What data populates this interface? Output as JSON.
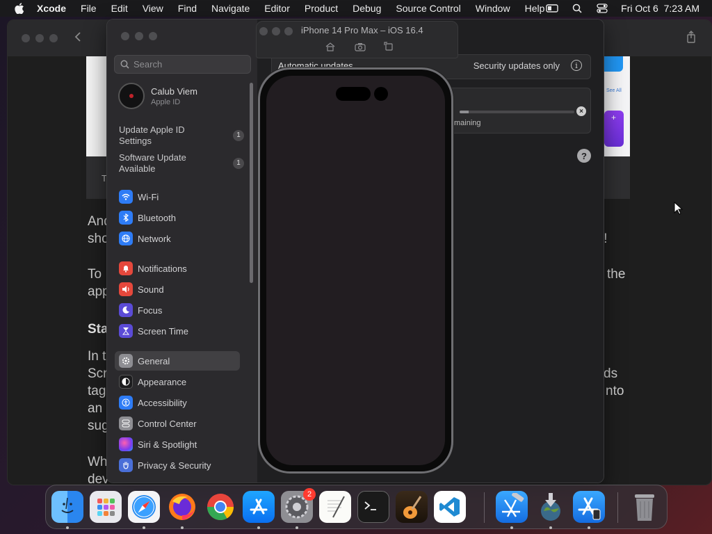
{
  "menubar": {
    "app": "Xcode",
    "items": [
      "File",
      "Edit",
      "View",
      "Find",
      "Navigate",
      "Editor",
      "Product",
      "Debug",
      "Source Control",
      "Window",
      "Help"
    ],
    "datetime": "Fri Oct 6  7:23 AM"
  },
  "browser": {
    "caption_left": "T",
    "fragments": {
      "and": "And",
      "sho": "sho",
      "t_excl": "t!",
      "to": "To",
      "the": "the",
      "app": "app",
      "sta": "Sta",
      "in_t": "In t",
      "scr": "Scr",
      "ds": "ds",
      "tag": "tag",
      "nto": "nto",
      "an_a": "an a",
      "sug": "sug",
      "wh": "Wh",
      "dev": "dev"
    },
    "see_all": "See All"
  },
  "settings": {
    "search_placeholder": "Search",
    "account": {
      "name": "Calub Viem",
      "subtitle": "Apple ID"
    },
    "notices": [
      {
        "label": "Update Apple ID Settings",
        "count": "1"
      },
      {
        "label": "Software Update Available",
        "count": "1"
      }
    ],
    "nav_items": [
      {
        "label": "Wi-Fi",
        "icon": "wifi-icon",
        "color": "#2e7cf6"
      },
      {
        "label": "Bluetooth",
        "icon": "bluetooth-icon",
        "color": "#2e7cf6"
      },
      {
        "label": "Network",
        "icon": "globe-icon",
        "color": "#2e7cf6"
      },
      {
        "label": "Notifications",
        "icon": "bell-icon",
        "color": "#e5483c"
      },
      {
        "label": "Sound",
        "icon": "speaker-icon",
        "color": "#e5483c"
      },
      {
        "label": "Focus",
        "icon": "moon-icon",
        "color": "#5b4bd6"
      },
      {
        "label": "Screen Time",
        "icon": "hourglass-icon",
        "color": "#5b4bd6"
      },
      {
        "label": "General",
        "icon": "gear-icon",
        "color": "#8e8e93"
      },
      {
        "label": "Appearance",
        "icon": "appearance-icon",
        "color": "#1c1c1e"
      },
      {
        "label": "Accessibility",
        "icon": "accessibility-icon",
        "color": "#2e7cf6"
      },
      {
        "label": "Control Center",
        "icon": "control-center-icon",
        "color": "#8e8e93"
      },
      {
        "label": "Siri & Spotlight",
        "icon": "siri-icon",
        "color": "#b43bd6"
      },
      {
        "label": "Privacy & Security",
        "icon": "hand-icon",
        "color": "#4a6fd8"
      }
    ],
    "selected": "General",
    "automatic_updates_label": "Automatic updates",
    "automatic_updates_value": "Security updates only",
    "progress_fraction": 0.08,
    "remaining_text": "maining"
  },
  "simulator": {
    "title": "iPhone 14 Pro Max – iOS 16.4"
  },
  "dock": {
    "apps": [
      {
        "name": "Finder",
        "icon": "finder-icon"
      },
      {
        "name": "Launchpad",
        "icon": "launchpad-icon"
      },
      {
        "name": "Safari",
        "icon": "safari-icon"
      },
      {
        "name": "Firefox",
        "icon": "firefox-icon"
      },
      {
        "name": "Chrome",
        "icon": "chrome-icon"
      },
      {
        "name": "App Store",
        "icon": "app-store-icon"
      },
      {
        "name": "System Settings",
        "icon": "system-settings-icon",
        "badge": "2"
      },
      {
        "name": "TextEdit",
        "icon": "textedit-icon"
      },
      {
        "name": "Terminal",
        "icon": "terminal-icon"
      },
      {
        "name": "GarageBand",
        "icon": "garageband-icon"
      },
      {
        "name": "Visual Studio Code",
        "icon": "vscode-icon"
      },
      {
        "name": "Xcode",
        "icon": "xcode-icon"
      },
      {
        "name": "Installer",
        "icon": "installer-icon"
      },
      {
        "name": "Simulator",
        "icon": "simulator-icon"
      },
      {
        "name": "Trash",
        "icon": "trash-icon"
      }
    ]
  }
}
